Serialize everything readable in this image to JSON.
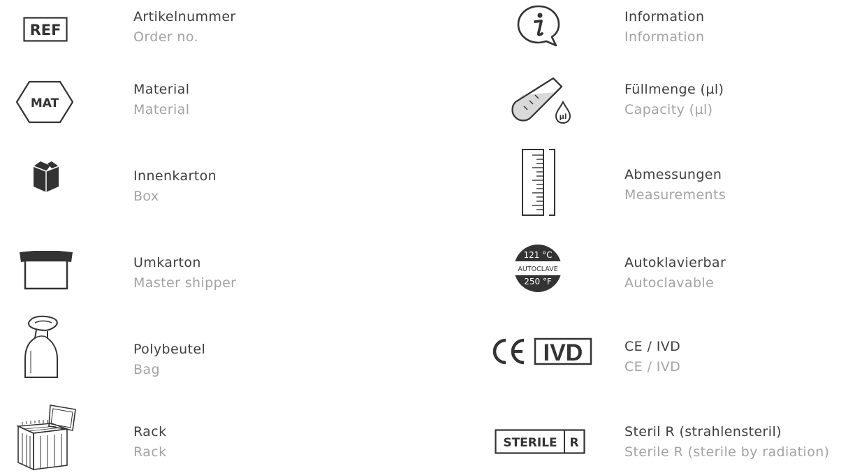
{
  "colors": {
    "icon": "#333333",
    "primary_text": "#3f3f3f",
    "secondary_text": "#a3a3a3"
  },
  "icons": {
    "ref": {
      "name": "ref-icon",
      "text": "REF"
    },
    "mat": {
      "name": "material-hexagon-icon",
      "text": "MAT"
    },
    "ul": {
      "name": "microliter-drop-icon",
      "text": "µl"
    },
    "autoclave": {
      "name": "autoclave-icon",
      "top": "121 °C",
      "middle": "AUTOCLAVE",
      "bottom": "250 °F"
    },
    "ce_ivd": {
      "name": "ce-ivd-icon",
      "ce": "CE",
      "ivd": "IVD"
    },
    "sterile": {
      "name": "sterile-r-icon",
      "sterile": "STERILE",
      "r": "R"
    }
  },
  "left_column": [
    {
      "de": "Artikelnummer",
      "en": "Order no.",
      "icon": "ref-icon"
    },
    {
      "de": "Material",
      "en": "Material",
      "icon": "material-hexagon-icon"
    },
    {
      "de": "Innenkarton",
      "en": "Box",
      "icon": "inner-box-icon"
    },
    {
      "de": "Umkarton",
      "en": "Master shipper",
      "icon": "open-carton-icon"
    },
    {
      "de": "Polybeutel",
      "en": "Bag",
      "icon": "polybag-icon"
    },
    {
      "de": "Rack",
      "en": "Rack",
      "icon": "rack-icon"
    }
  ],
  "right_column": [
    {
      "de": "Information",
      "en": "Information",
      "icon": "info-bubble-icon"
    },
    {
      "de": "Füllmenge (µl)",
      "en": "Capacity (µl)",
      "icon": "test-tube-icon"
    },
    {
      "de": "Abmessungen",
      "en": "Measurements",
      "icon": "ruler-icon"
    },
    {
      "de": "Autoklavierbar",
      "en": "Autoclavable",
      "icon": "autoclave-icon"
    },
    {
      "de": "CE / IVD",
      "en": "CE / IVD",
      "icon": "ce-ivd-icon"
    },
    {
      "de": "Steril R (strahlensteril)",
      "en": "Sterile R (sterile by radiation)",
      "icon": "sterile-r-icon"
    }
  ]
}
